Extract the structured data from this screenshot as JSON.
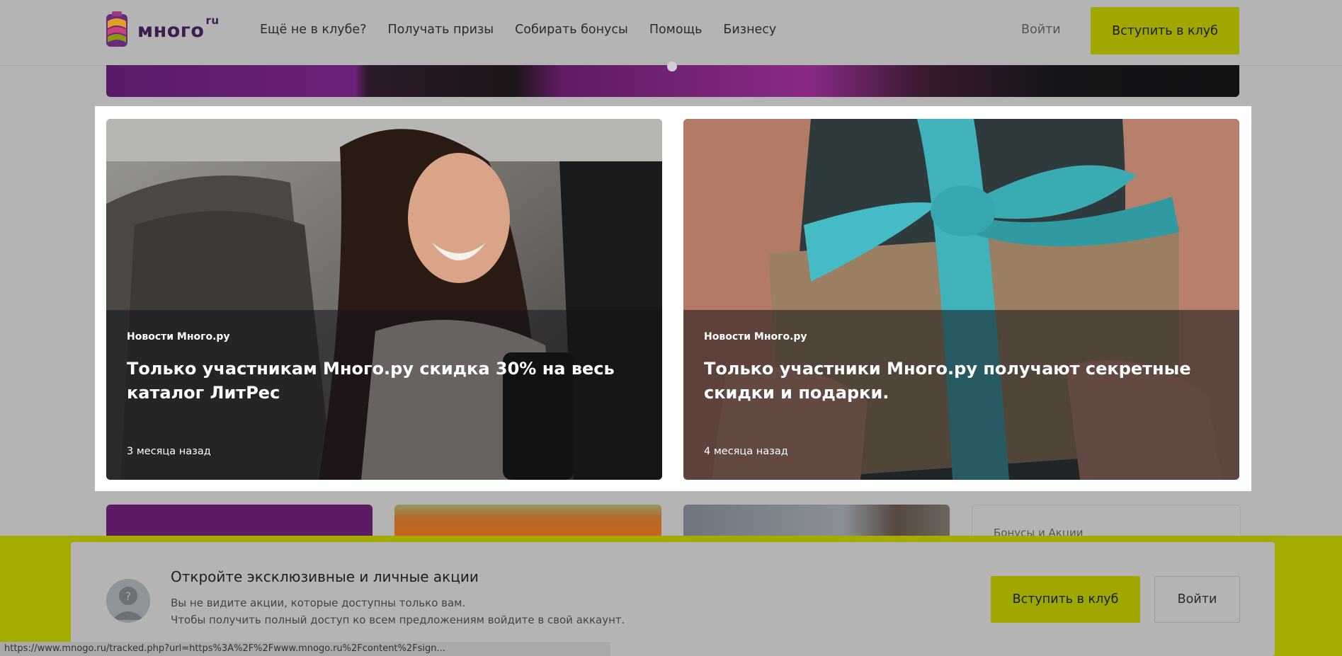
{
  "header": {
    "logo_text": "много",
    "logo_suffix": "ru",
    "nav": [
      {
        "label": "Ещё не в клубе?"
      },
      {
        "label": "Получать призы"
      },
      {
        "label": "Собирать бонусы"
      },
      {
        "label": "Помощь"
      },
      {
        "label": "Бизнесу"
      }
    ],
    "login_label": "Войти",
    "join_label": "Вступить в клуб"
  },
  "cards": [
    {
      "category": "Новости Много.ру",
      "title": "Только участникам Много.ру скидка 30% на весь каталог ЛитРес",
      "time": "3 месяца назад"
    },
    {
      "category": "Новости Много.ру",
      "title": "Только участники Много.ру получают секретные скидки и подарки.",
      "time": "4 месяца назад"
    }
  ],
  "bottom_row": {
    "side_label": "Бонусы и Акции"
  },
  "notice": {
    "title": "Откройте эксклюзивные и личные акции",
    "line1": "Вы не видите акции, которые доступны только вам.",
    "line2": "Чтобы получить полный доступ ко всем предложениям войдите в свой аккаунт.",
    "join_label": "Вступить в клуб",
    "login_label": "Войти"
  },
  "status_bar": {
    "url": "https://www.mnogo.ru/tracked.php?url=https%3A%2F%2Fwww.mnogo.ru%2Fcontent%2Fsign..."
  },
  "colors": {
    "accent": "#a0a800",
    "brand": "#3d1b53",
    "dim_background": "#b4b4b4"
  }
}
